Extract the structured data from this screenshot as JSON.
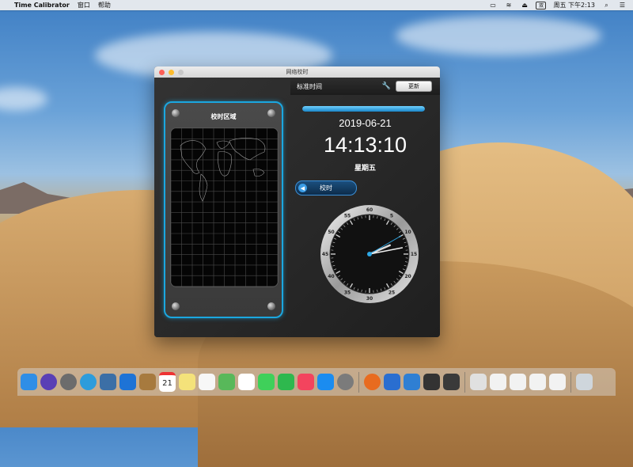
{
  "menubar": {
    "app_name": "Time Calibrator",
    "menus": [
      "窗口",
      "帮助"
    ],
    "datetime": "周五 下午2:13",
    "input_method": "双"
  },
  "window": {
    "title": "网络校时",
    "zone_panel": {
      "title": "校时区域"
    },
    "header": {
      "label": "标准时间",
      "refresh_label": "更新"
    },
    "progress": 1.0,
    "date": "2019-06-21",
    "time": "14:13:10",
    "weekday": "星期五",
    "calibrate_label": "校时",
    "clock": {
      "hours": 14,
      "minutes": 13,
      "seconds": 10,
      "dial_labels": [
        "60",
        "5",
        "10",
        "15",
        "20",
        "25",
        "30",
        "35",
        "40",
        "45",
        "50",
        "55"
      ]
    }
  },
  "colors": {
    "accent": "#1ba7e0"
  },
  "dock": {
    "calendar_day": "21",
    "icons": [
      {
        "name": "finder-icon",
        "color": "#2f8ee6"
      },
      {
        "name": "siri-icon",
        "color": "#5a3fb5"
      },
      {
        "name": "launchpad-icon",
        "color": "#6c6c6c"
      },
      {
        "name": "safari-icon",
        "color": "#2d9cdb"
      },
      {
        "name": "photo-viewer-icon",
        "color": "#3c6fa6"
      },
      {
        "name": "screen-sharing-icon",
        "color": "#1e73d6"
      },
      {
        "name": "notes-icon",
        "color": "#a77a3e"
      },
      {
        "name": "calendar-icon",
        "color": "#ffffff"
      },
      {
        "name": "stickies-icon",
        "color": "#f4e27a"
      },
      {
        "name": "reminders-icon",
        "color": "#f7f7f7"
      },
      {
        "name": "maps-icon",
        "color": "#58b85a"
      },
      {
        "name": "photos-icon",
        "color": "#ffffff"
      },
      {
        "name": "messages-icon",
        "color": "#3fd05a"
      },
      {
        "name": "facetime-icon",
        "color": "#2eb84e"
      },
      {
        "name": "music-icon",
        "color": "#f3445e"
      },
      {
        "name": "app-store-icon",
        "color": "#1b8cf0"
      },
      {
        "name": "system-preferences-icon",
        "color": "#7b7b7b"
      },
      {
        "name": "firefox-icon",
        "color": "#e86b1f"
      },
      {
        "name": "xcode-icon",
        "color": "#2a6ed0"
      },
      {
        "name": "instruments-icon",
        "color": "#2f7fd3"
      },
      {
        "name": "time-calibrator-icon",
        "color": "#333333"
      },
      {
        "name": "photo-booth-icon",
        "color": "#3a3a3a"
      },
      {
        "name": "preview-thumb-icon",
        "color": "#e0e0e0"
      },
      {
        "name": "window-thumb-1-icon",
        "color": "#f2f2f2"
      },
      {
        "name": "window-thumb-2-icon",
        "color": "#f2f2f2"
      },
      {
        "name": "window-thumb-3-icon",
        "color": "#f2f2f2"
      },
      {
        "name": "window-thumb-4-icon",
        "color": "#f2f2f2"
      },
      {
        "name": "trash-icon",
        "color": "#cfd6dc"
      }
    ]
  }
}
